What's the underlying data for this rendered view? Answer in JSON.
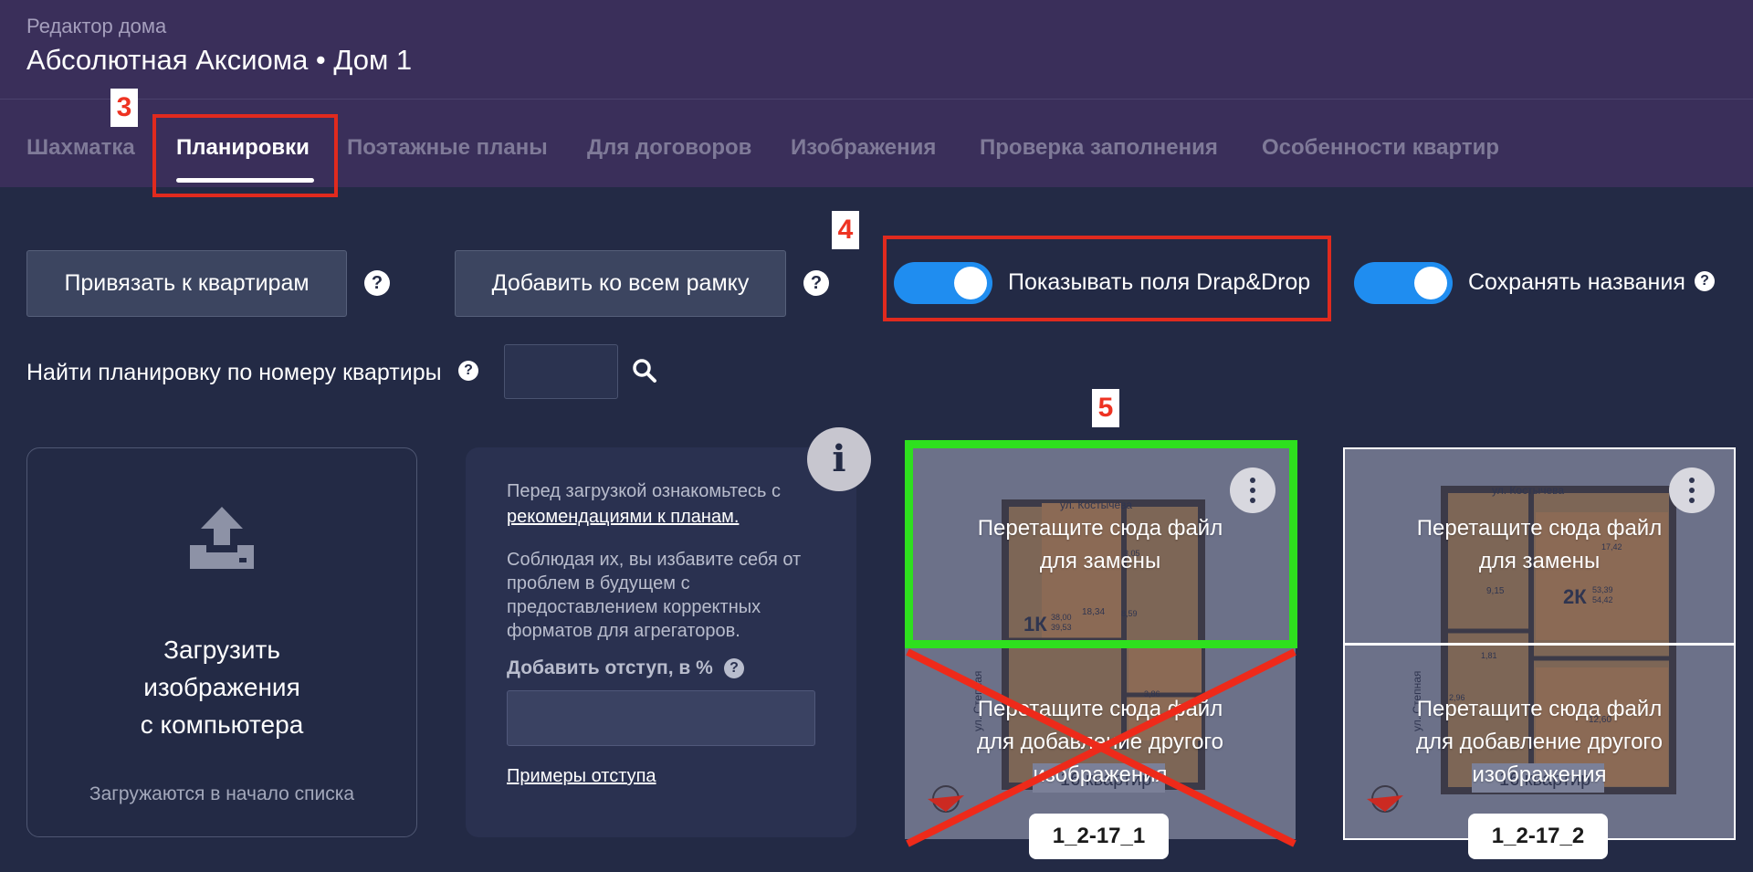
{
  "header": {
    "subtitle": "Редактор дома",
    "title": "Абсолютная Аксиома • Дом 1"
  },
  "tabs": [
    {
      "label": "Шахматка",
      "active": false
    },
    {
      "label": "Планировки",
      "active": true
    },
    {
      "label": "Поэтажные планы",
      "active": false
    },
    {
      "label": "Для договоров",
      "active": false
    },
    {
      "label": "Изображения",
      "active": false
    },
    {
      "label": "Проверка заполнения",
      "active": false
    },
    {
      "label": "Особенности квартир",
      "active": false
    }
  ],
  "annotations": {
    "marker_3": "3",
    "marker_4": "4",
    "marker_5": "5",
    "highlight_color": "#e02a1e",
    "dropzone_highlight_color": "#2ee01e"
  },
  "toolbar": {
    "link_button": "Привязать к квартирам",
    "frame_button": "Добавить ко всем рамку",
    "help_glyph": "?",
    "toggle_dnd": {
      "label": "Показывать поля Drap&Drop",
      "on": true
    },
    "toggle_names": {
      "label": "Сохранять названия",
      "on": true
    },
    "toggle_color": "#1f8df0"
  },
  "search": {
    "label": "Найти планировку по номеру квартиры",
    "value": ""
  },
  "upload": {
    "title": "Загрузить\nизображения\nс компьютера",
    "note": "Загружаются в начало списка"
  },
  "info": {
    "badge": "i",
    "intro": "Перед загрузкой ознакомьтесь с",
    "recommend_link": "рекомендациями к планам.",
    "body": "Соблюдая их, вы избавите себя от проблем в будущем с предоставлением корректных форматов для агрегаторов.",
    "padding_label": "Добавить отступ, в %",
    "padding_value": "",
    "examples_link": "Примеры отступа"
  },
  "plans": [
    {
      "name": "1_2-17_1",
      "street_top": "ул. Костычева",
      "street_side": "ул. Степная",
      "flat_type": "1К",
      "flat_area_top": "38,00",
      "flat_area_bottom": "39,53",
      "room_areas": [
        "18,34",
        "8,59",
        "3,05",
        "3,86"
      ],
      "count_label": "16 квартир",
      "drop_replace": "Перетащите сюда файл\nдля замены",
      "drop_add": "Перетащите сюда файл\nдля добавление другого\nизображения"
    },
    {
      "name": "1_2-17_2",
      "street_top": "ул. Костычева",
      "street_side": "ул. Степная",
      "flat_type": "2К",
      "flat_area_top": "53,39",
      "flat_area_bottom": "54,42",
      "room_areas": [
        "17,42",
        "9,15",
        "1,81",
        "2,96",
        "12,60"
      ],
      "count_label": "16 квартир",
      "drop_replace": "Перетащите сюда файл\nдля замены",
      "drop_add": "Перетащите сюда файл\nдля добавление другого\nизображения"
    }
  ]
}
